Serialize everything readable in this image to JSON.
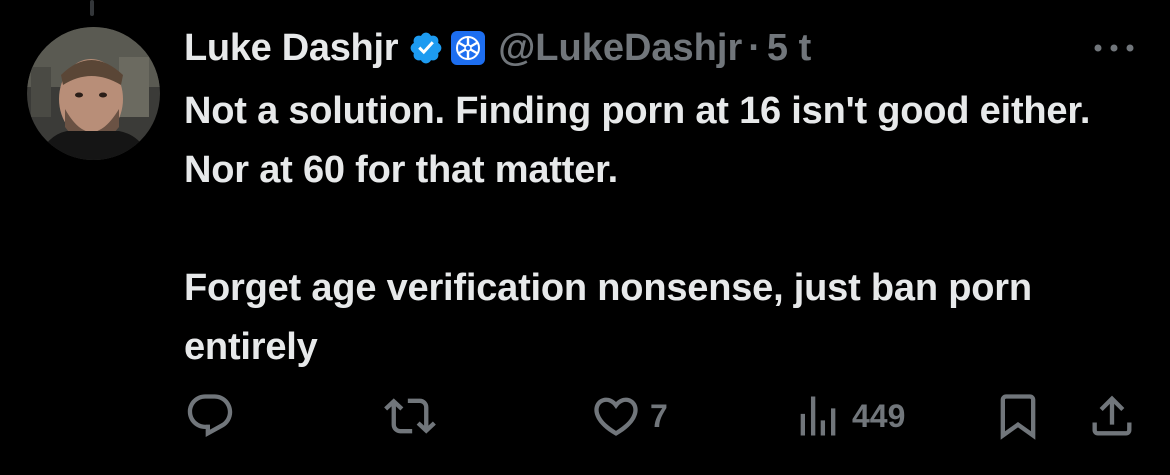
{
  "tweet": {
    "author": {
      "display_name": "Luke Dashjr",
      "handle": "@LukeDashjr",
      "verified": true
    },
    "separator": "·",
    "time": "5 t",
    "text_paragraphs": [
      "Not a solution. Finding porn at 16 isn't good either. Nor at 60 for that matter.",
      "Forget age verification nonsense, just ban porn entirely"
    ],
    "actions": {
      "reply": {
        "icon": "reply-icon",
        "count": ""
      },
      "repost": {
        "icon": "repost-icon",
        "count": ""
      },
      "like": {
        "icon": "heart-icon",
        "count": "7"
      },
      "views": {
        "icon": "views-icon",
        "count": "449"
      },
      "bookmark": {
        "icon": "bookmark-icon"
      },
      "share": {
        "icon": "share-icon"
      }
    }
  },
  "colors": {
    "background": "#000000",
    "text_primary": "#e7e9ea",
    "text_secondary": "#71767b",
    "verified_blue": "#1d9bf0",
    "thread_line": "#333639"
  }
}
